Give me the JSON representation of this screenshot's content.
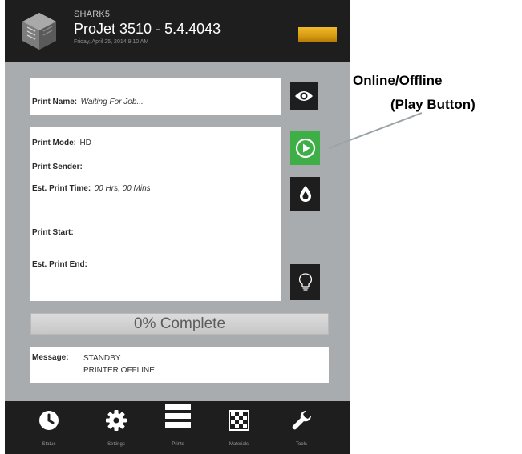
{
  "header": {
    "printer_name": "SHARK5",
    "model_version": "ProJet 3510 - 5.4.4043",
    "datetime": "Friday, April 25, 2014 9:10 AM",
    "status_light_color": "#e3a51a"
  },
  "print_name": {
    "label": "Print Name:",
    "value": "Waiting For Job..."
  },
  "info": {
    "print_mode_label": "Print Mode:",
    "print_mode_value": "HD",
    "print_sender_label": "Print Sender:",
    "est_print_time_label": "Est. Print Time:",
    "est_print_time_value": "00 Hrs, 00 Mins",
    "print_start_label": "Print Start:",
    "est_print_end_label": "Est. Print End:"
  },
  "progress": {
    "text": "0% Complete",
    "fraction": 0
  },
  "message": {
    "label": "Message:",
    "line1": "STANDBY",
    "line2": "PRINTER OFFLINE"
  },
  "side_buttons": {
    "eye_icon": "eye-icon",
    "play_icon": "play-icon",
    "play_color": "#3eae47",
    "ink_icon": "drop-icon",
    "bulb_icon": "lightbulb-icon"
  },
  "nav": [
    {
      "label": "Status",
      "icon": "clock-icon"
    },
    {
      "label": "Settings",
      "icon": "gear-icon"
    },
    {
      "label": "Prints",
      "icon": "list-icon"
    },
    {
      "label": "Materials",
      "icon": "checker-icon"
    },
    {
      "label": "Tools",
      "icon": "wrench-icon"
    }
  ],
  "annotation": {
    "line1": "Online/Offline",
    "line2": "(Play Button)"
  }
}
